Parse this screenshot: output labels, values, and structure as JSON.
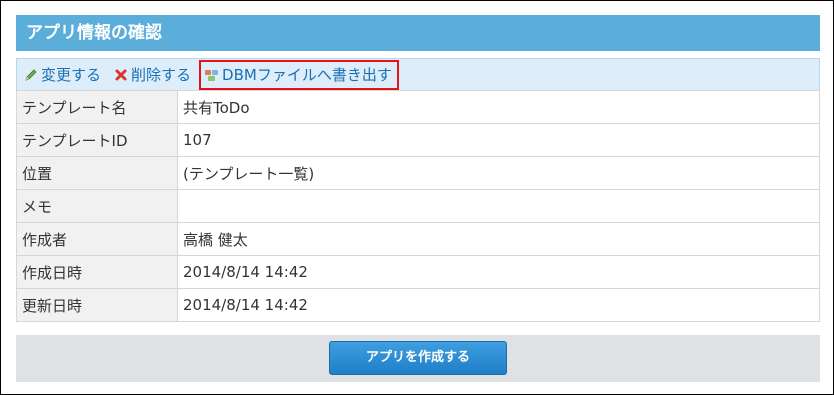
{
  "header": {
    "title": "アプリ情報の確認"
  },
  "toolbar": {
    "edit_label": "変更する",
    "delete_label": "削除する",
    "export_label": "DBMファイルへ書き出す",
    "edit_icon": "pencil-icon",
    "delete_icon": "x-icon",
    "export_icon": "db-export-icon",
    "highlight_color": "#e2131c"
  },
  "rows": [
    {
      "label": "テンプレート名",
      "value": "共有ToDo"
    },
    {
      "label": "テンプレートID",
      "value": "107"
    },
    {
      "label": "位置",
      "value": "(テンプレート一覧)"
    },
    {
      "label": "メモ",
      "value": ""
    },
    {
      "label": "作成者",
      "value": "高橋 健太"
    },
    {
      "label": "作成日時",
      "value": "2014/8/14 14:42"
    },
    {
      "label": "更新日時",
      "value": "2014/8/14 14:42"
    }
  ],
  "footer": {
    "create_label": "アプリを作成する"
  },
  "colors": {
    "header_bg": "#5aaed9",
    "toolbar_bg": "#ddeefa",
    "link": "#1a6fb5",
    "button_bg": "#2a8ad4"
  }
}
